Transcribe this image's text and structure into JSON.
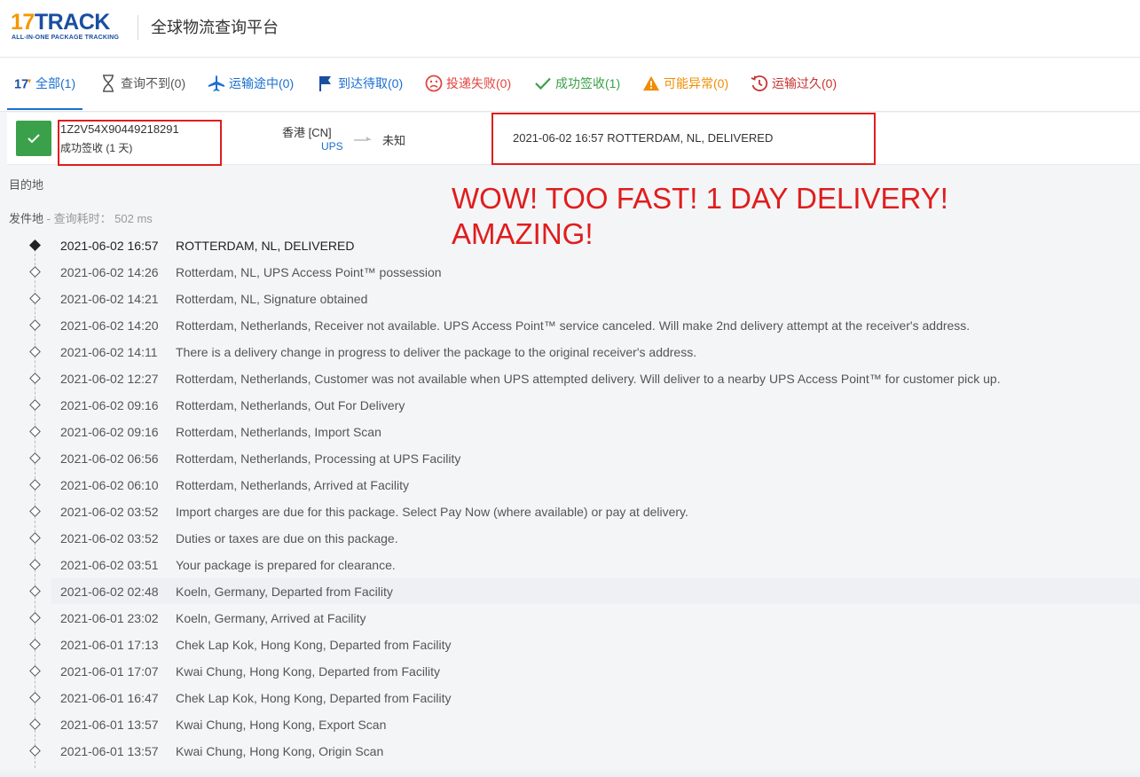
{
  "header": {
    "logo_num": "17",
    "logo_word": "TRACK",
    "logo_tagline": "ALL-IN-ONE PACKAGE TRACKING",
    "title": "全球物流查询平台"
  },
  "tabs": [
    {
      "label": "全部(1)",
      "icon": "17-logo-icon",
      "color": "#1a6fd0"
    },
    {
      "label": "查询不到(0)",
      "icon": "hourglass-icon",
      "color": "#555555"
    },
    {
      "label": "运输途中(0)",
      "icon": "airplane-icon",
      "color": "#1a6fd0"
    },
    {
      "label": "到达待取(0)",
      "icon": "flag-icon",
      "color": "#1a6fd0"
    },
    {
      "label": "投递失败(0)",
      "icon": "sad-face-icon",
      "color": "#e2443f"
    },
    {
      "label": "成功签收(1)",
      "icon": "checkmark-icon",
      "color": "#3aa14a"
    },
    {
      "label": "可能异常(0)",
      "icon": "warning-icon",
      "color": "#f08c00"
    },
    {
      "label": "运输过久(0)",
      "icon": "history-clock-icon",
      "color": "#c8342f"
    }
  ],
  "result": {
    "tracking_number": "1Z2V54X90449218291",
    "status": "成功签收 (1 天)",
    "origin": "香港 [CN]",
    "carrier": "UPS",
    "destination": "未知",
    "latest_event": "2021-06-02 16:57  ROTTERDAM, NL, DELIVERED"
  },
  "details": {
    "destination_label": "目的地",
    "origin_label": "发件地",
    "query_time": " - 查询耗时： 502 ms"
  },
  "overlay_note": "WOW! TOO FAST! 1 DAY DELIVERY!\nAMAZING!",
  "events": [
    {
      "time": "2021-06-02 16:57",
      "desc": "ROTTERDAM, NL, DELIVERED"
    },
    {
      "time": "2021-06-02 14:26",
      "desc": "Rotterdam, NL, UPS Access Point™ possession"
    },
    {
      "time": "2021-06-02 14:21",
      "desc": "Rotterdam, NL, Signature obtained"
    },
    {
      "time": "2021-06-02 14:20",
      "desc": "Rotterdam, Netherlands, Receiver not available. UPS Access Point™ service canceled. Will make 2nd delivery attempt at the receiver's address."
    },
    {
      "time": "2021-06-02 14:11",
      "desc": "There is a delivery change in progress to deliver the package to the original receiver's address."
    },
    {
      "time": "2021-06-02 12:27",
      "desc": "Rotterdam, Netherlands, Customer was not available when UPS attempted delivery. Will deliver to a nearby UPS Access Point™ for customer pick up."
    },
    {
      "time": "2021-06-02 09:16",
      "desc": "Rotterdam, Netherlands, Out For Delivery"
    },
    {
      "time": "2021-06-02 09:16",
      "desc": "Rotterdam, Netherlands, Import Scan"
    },
    {
      "time": "2021-06-02 06:56",
      "desc": "Rotterdam, Netherlands, Processing at UPS Facility"
    },
    {
      "time": "2021-06-02 06:10",
      "desc": "Rotterdam, Netherlands, Arrived at Facility"
    },
    {
      "time": "2021-06-02 03:52",
      "desc": "Import charges are due for this package. Select Pay Now (where available) or pay at delivery."
    },
    {
      "time": "2021-06-02 03:52",
      "desc": "Duties or taxes are due on this package."
    },
    {
      "time": "2021-06-02 03:51",
      "desc": "Your package is prepared for clearance."
    },
    {
      "time": "2021-06-02 02:48",
      "desc": "Koeln, Germany, Departed from Facility"
    },
    {
      "time": "2021-06-01 23:02",
      "desc": "Koeln, Germany, Arrived at Facility"
    },
    {
      "time": "2021-06-01 17:13",
      "desc": "Chek Lap Kok, Hong Kong, Departed from Facility"
    },
    {
      "time": "2021-06-01 17:07",
      "desc": "Kwai Chung, Hong Kong, Departed from Facility"
    },
    {
      "time": "2021-06-01 16:47",
      "desc": "Chek Lap Kok, Hong Kong, Departed from Facility"
    },
    {
      "time": "2021-06-01 13:57",
      "desc": "Kwai Chung, Hong Kong, Export Scan"
    },
    {
      "time": "2021-06-01 13:57",
      "desc": "Kwai Chung, Hong Kong, Origin Scan"
    }
  ]
}
